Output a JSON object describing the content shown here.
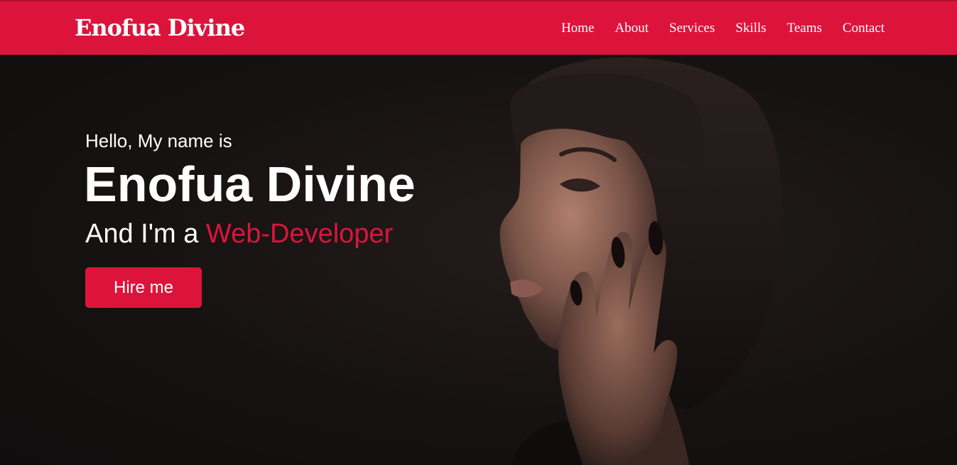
{
  "colors": {
    "accent": "#dc143c",
    "background": "#141111",
    "text": "#ffffff"
  },
  "navbar": {
    "logo": "Enofua Divine",
    "menu": [
      "Home",
      "About",
      "Services",
      "Skills",
      "Teams",
      "Contact"
    ]
  },
  "hero": {
    "greeting": "Hello, My name is",
    "name": "Enofua Divine",
    "role_prefix": "And I'm a ",
    "role_accent": "Web-Developer",
    "button_label": "Hire me"
  }
}
